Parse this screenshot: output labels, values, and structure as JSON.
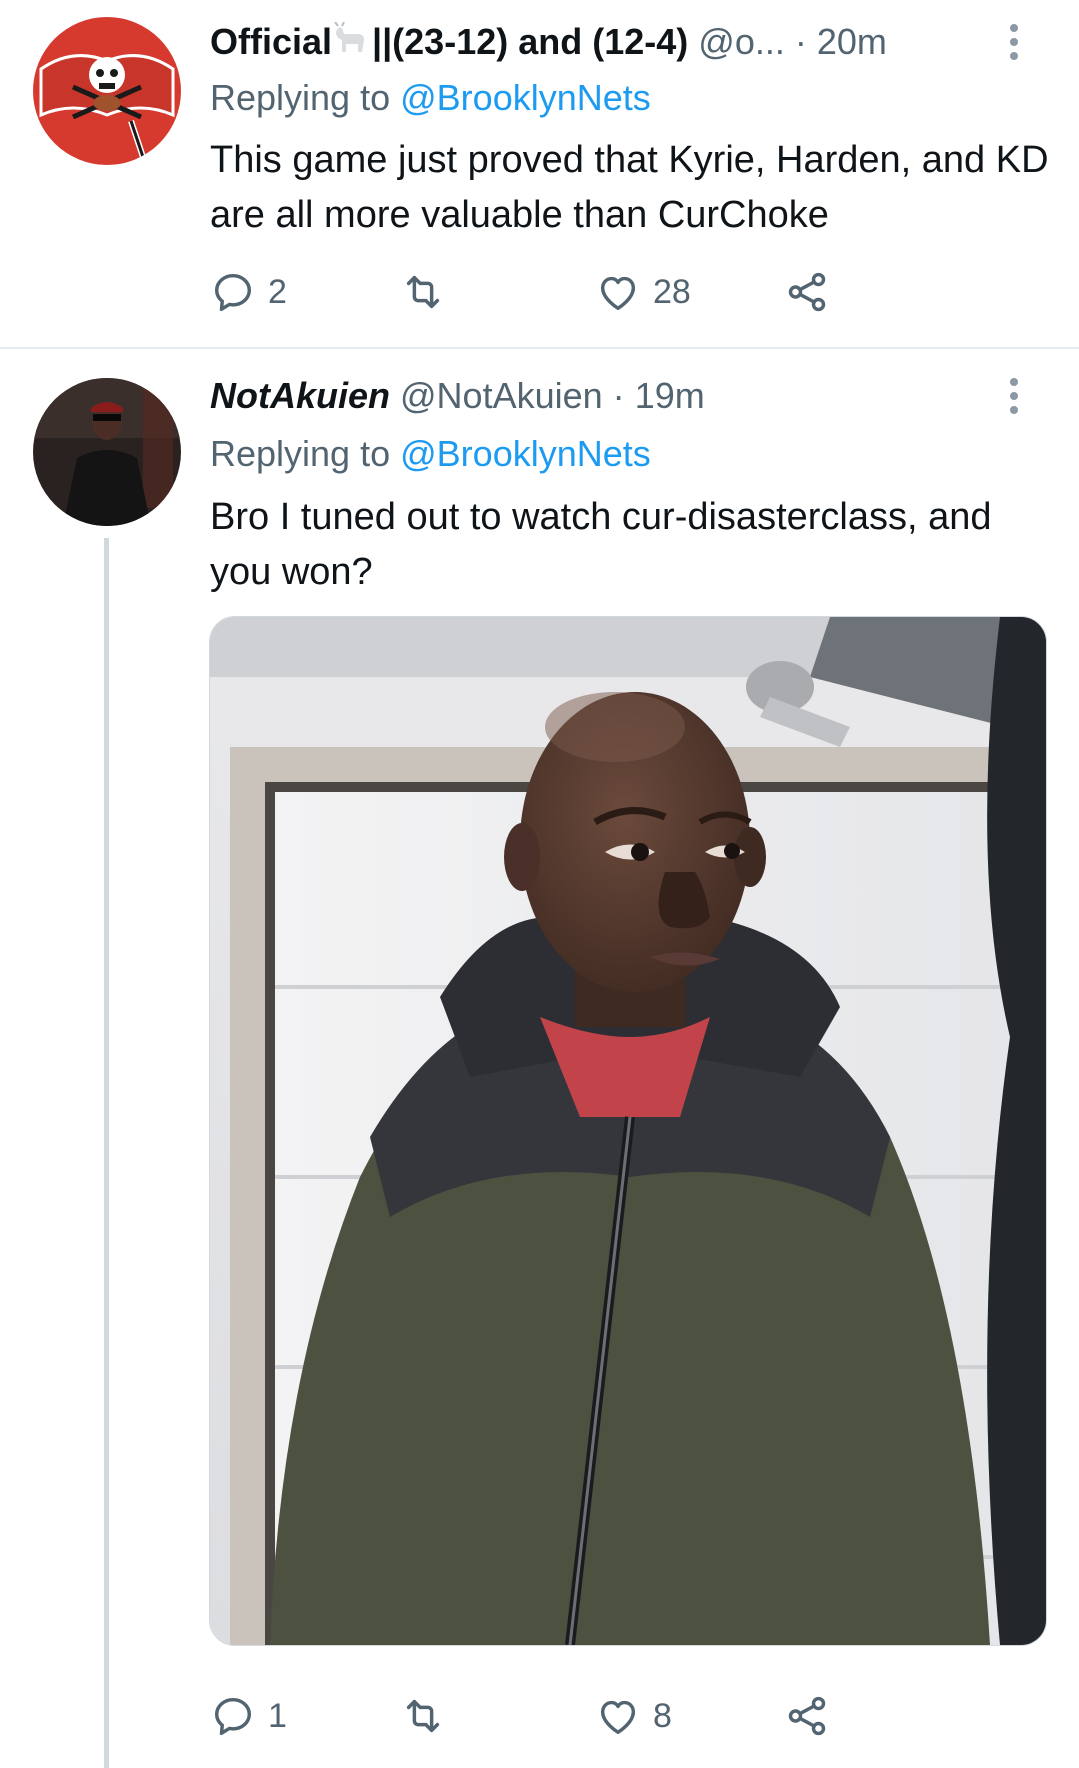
{
  "tweets": [
    {
      "display_name": "Official",
      "display_name_suffix": "||(23-12) and (12-4)",
      "handle": "@o...",
      "time": "20m",
      "replying_to_prefix": "Replying to",
      "replying_to": "@BrooklynNets",
      "text": "This game just proved that Kyrie, Harden, and KD are all more valuable than CurChoke",
      "actions": {
        "replies": "2",
        "retweets": "",
        "likes": "28"
      }
    },
    {
      "display_name": "NotAkuien",
      "handle": "@NotAkuien",
      "time": "19m",
      "replying_to_prefix": "Replying to",
      "replying_to": "@BrooklynNets",
      "text": "Bro I tuned out to watch cur-disasterclass, and you won?",
      "actions": {
        "replies": "1",
        "retweets": "",
        "likes": "8"
      }
    }
  ],
  "colors": {
    "accent": "#1d9bf0",
    "secondary_text": "#536471",
    "divider": "#e6ecf0"
  },
  "icons": [
    "reply-icon",
    "retweet-icon",
    "like-icon",
    "share-icon",
    "more-icon"
  ]
}
